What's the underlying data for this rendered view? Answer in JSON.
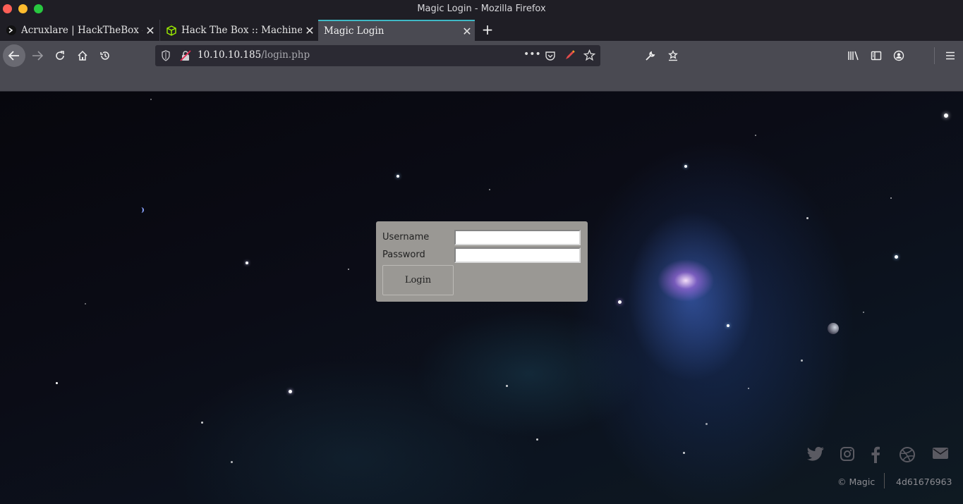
{
  "window": {
    "title": "Magic Login - Mozilla Firefox"
  },
  "tabs": [
    {
      "label": "Acruxlare | HackTheBox - F",
      "icon": "terminal-icon"
    },
    {
      "label": "Hack The Box :: Machines",
      "icon": "htb-cube-icon"
    },
    {
      "label": "Magic Login",
      "icon": "none",
      "active": true
    }
  ],
  "urlbar": {
    "host": "10.10.10.185",
    "path": "/login.php"
  },
  "login": {
    "username_label": "Username",
    "password_label": "Password",
    "username_value": "",
    "password_value": "",
    "button_label": "Login"
  },
  "footer": {
    "copyright": "© Magic",
    "hash": "4d61676963",
    "social_icons": [
      "twitter-icon",
      "instagram-icon",
      "facebook-icon",
      "dribbble-icon",
      "mail-icon"
    ]
  },
  "colors": {
    "accent_tab": "#3fb9c6",
    "toolbar": "#4a4a52",
    "login_panel": "#9a9894"
  }
}
